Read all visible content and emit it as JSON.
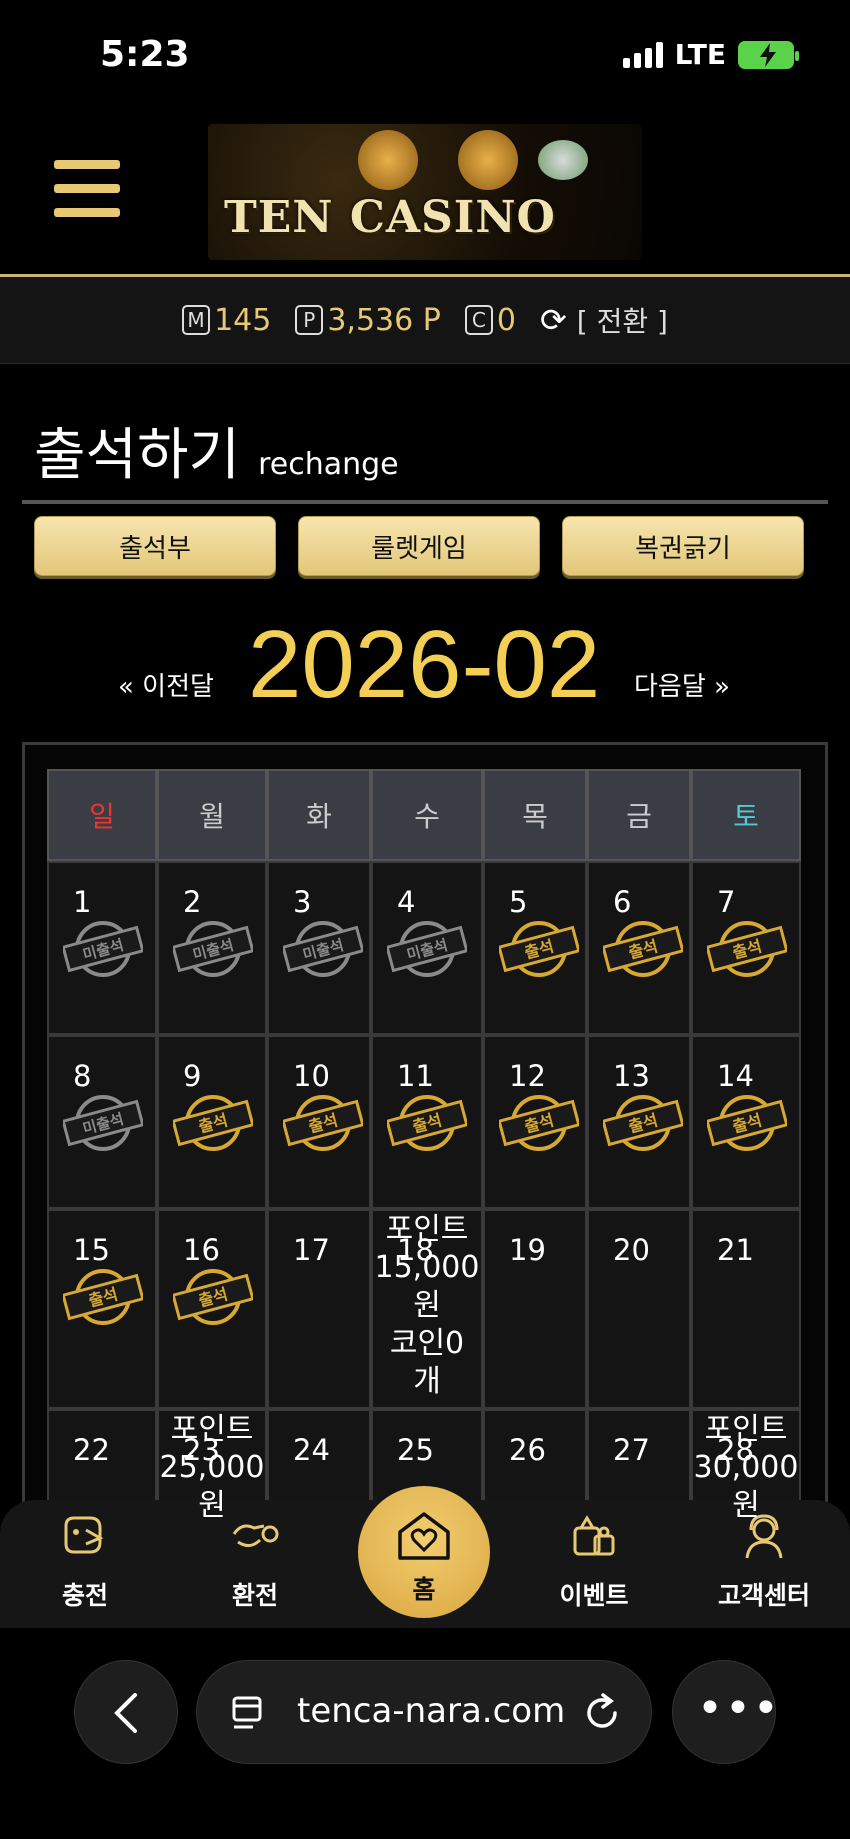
{
  "status": {
    "time": "5:23",
    "network": "LTE"
  },
  "brand": {
    "logo_text": "TEN CASINO"
  },
  "points": {
    "m_icon": "M",
    "m_value": "145",
    "p_icon": "P",
    "p_value": "3,536 P",
    "c_icon": "C",
    "c_value": "0",
    "switch_label": "[ 전환 ]"
  },
  "page": {
    "title": "출석하기",
    "subtitle": "rechange"
  },
  "tabs": [
    {
      "label": "출석부"
    },
    {
      "label": "룰렛게임"
    },
    {
      "label": "복권긁기"
    }
  ],
  "month_nav": {
    "prev": "« 이전달",
    "current": "2026-02",
    "next": "다음달 »"
  },
  "calendar": {
    "weekdays": [
      "일",
      "월",
      "화",
      "수",
      "목",
      "금",
      "토"
    ],
    "weekday_colors": {
      "sun": "#e33333",
      "sat": "#58c8d8"
    },
    "stamp_labels": {
      "attended": "출석",
      "absent": "미출석"
    },
    "stamp_colors": {
      "attended": "#d7a832",
      "absent": "#8a8a8a"
    },
    "rows": [
      [
        {
          "day": "1",
          "stamp": "absent"
        },
        {
          "day": "2",
          "stamp": "absent"
        },
        {
          "day": "3",
          "stamp": "absent"
        },
        {
          "day": "4",
          "stamp": "absent"
        },
        {
          "day": "5",
          "stamp": "attended"
        },
        {
          "day": "6",
          "stamp": "attended"
        },
        {
          "day": "7",
          "stamp": "attended"
        }
      ],
      [
        {
          "day": "8",
          "stamp": "absent"
        },
        {
          "day": "9",
          "stamp": "attended"
        },
        {
          "day": "10",
          "stamp": "attended"
        },
        {
          "day": "11",
          "stamp": "attended"
        },
        {
          "day": "12",
          "stamp": "attended"
        },
        {
          "day": "13",
          "stamp": "attended"
        },
        {
          "day": "14",
          "stamp": "attended"
        }
      ],
      [
        {
          "day": "15",
          "stamp": "attended"
        },
        {
          "day": "16",
          "stamp": "attended"
        },
        {
          "day": "17",
          "stamp": ""
        },
        {
          "day": "18",
          "stamp": "",
          "note": "포인트\n15,000\n원\n코인0\n개"
        },
        {
          "day": "19",
          "stamp": ""
        },
        {
          "day": "20",
          "stamp": ""
        },
        {
          "day": "21",
          "stamp": ""
        }
      ],
      [
        {
          "day": "22",
          "stamp": ""
        },
        {
          "day": "23",
          "stamp": "",
          "note": "포인트\n25,000\n원"
        },
        {
          "day": "24",
          "stamp": ""
        },
        {
          "day": "25",
          "stamp": ""
        },
        {
          "day": "26",
          "stamp": ""
        },
        {
          "day": "27",
          "stamp": ""
        },
        {
          "day": "28",
          "stamp": "",
          "note": "포인트\n30,000\n원"
        }
      ]
    ]
  },
  "bottom_nav": [
    {
      "label": "충전",
      "icon": "charge-icon"
    },
    {
      "label": "환전",
      "icon": "exchange-icon"
    },
    {
      "label": "홈",
      "icon": "home-heart-icon"
    },
    {
      "label": "이벤트",
      "icon": "gift-icon"
    },
    {
      "label": "고객센터",
      "icon": "support-icon"
    }
  ],
  "browser": {
    "url": "tenca-nara.com"
  },
  "colors": {
    "accent_gold": "#e7c873",
    "month_yellow": "#f3cf55",
    "background": "#000000"
  }
}
